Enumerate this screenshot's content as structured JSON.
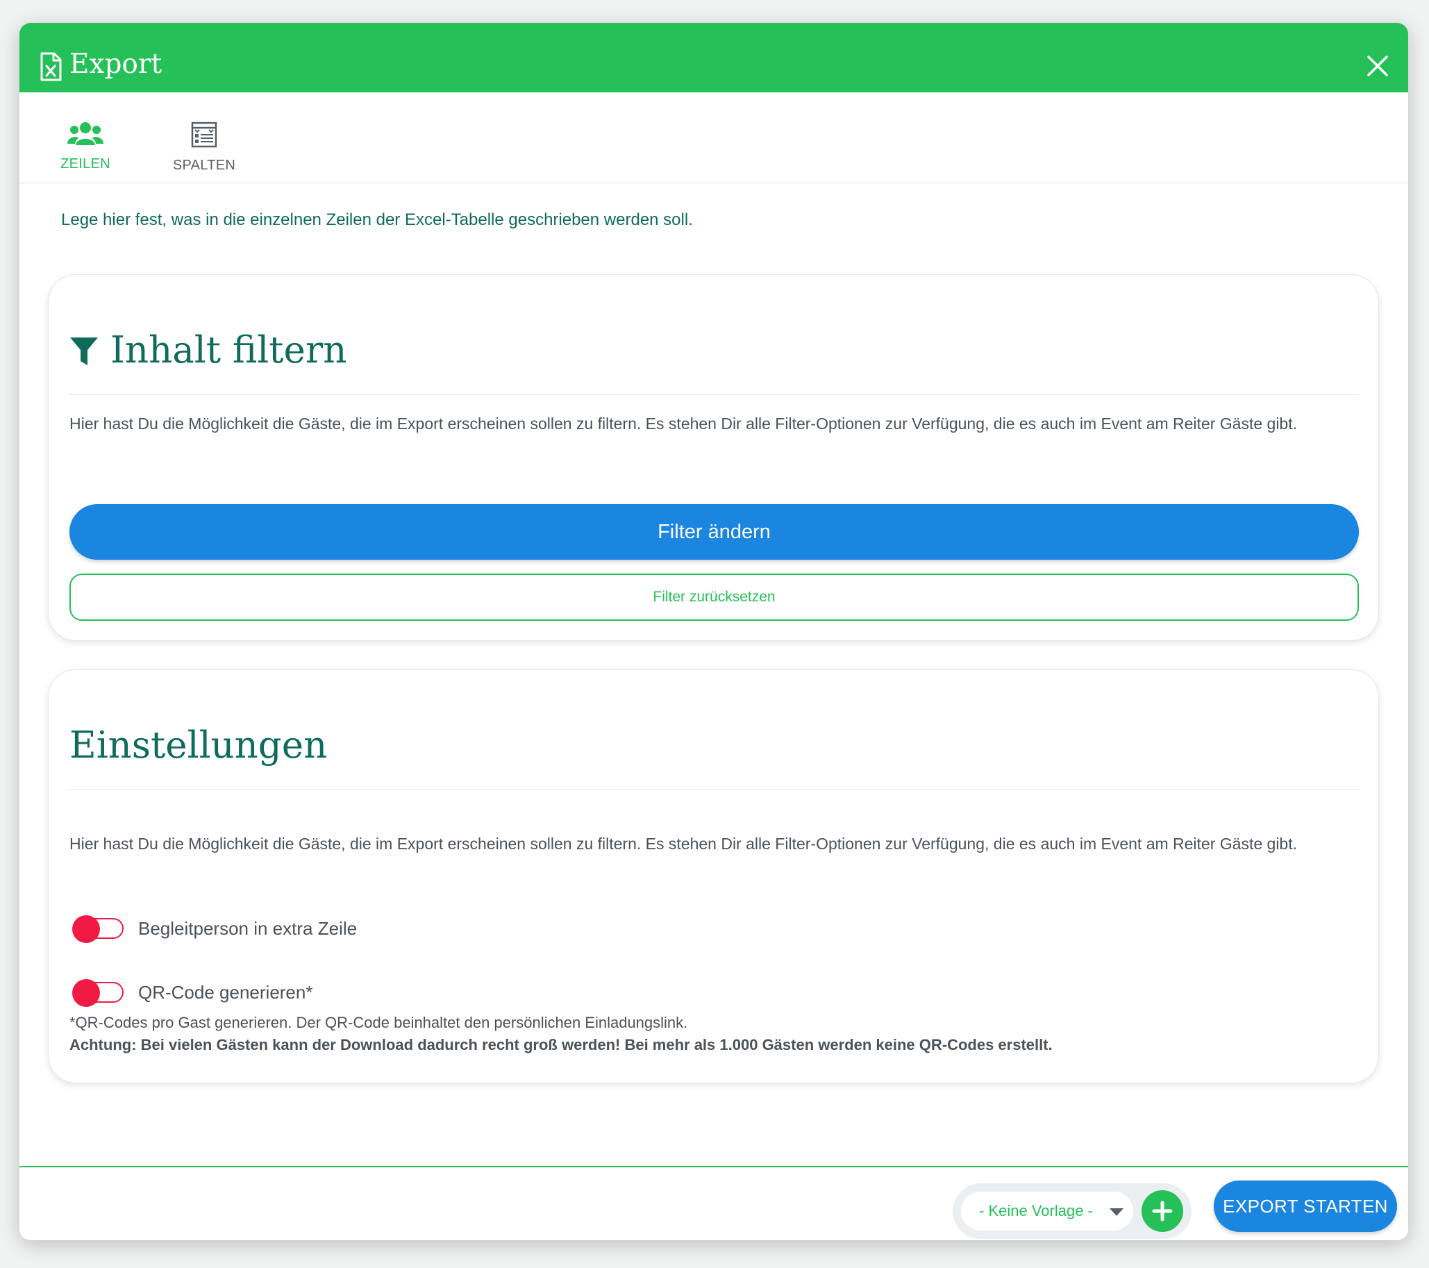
{
  "header": {
    "title": "Export",
    "icon": "excel-file-icon",
    "close_icon": "close-icon"
  },
  "tabs": [
    {
      "label": "ZEILEN",
      "icon": "users-icon",
      "active": true
    },
    {
      "label": "SPALTEN",
      "icon": "columns-table-icon",
      "active": false
    }
  ],
  "intro": "Lege hier fest, was in die einzelnen Zeilen der Excel-Tabelle geschrieben werden soll.",
  "filter_card": {
    "title": "Inhalt filtern",
    "icon": "funnel-icon",
    "description": "Hier hast Du die Möglichkeit die Gäste, die im Export erscheinen sollen zu filtern. Es stehen Dir alle Filter-Optionen zur Verfügung, die es auch im Event am Reiter Gäste gibt.",
    "change_button": "Filter ändern",
    "reset_button": "Filter zurücksetzen"
  },
  "settings_card": {
    "title": "Einstellungen",
    "description": "Hier hast Du die Möglichkeit die Gäste, die im Export erscheinen sollen zu filtern. Es stehen Dir alle Filter-Optionen zur Verfügung, die es auch im Event am Reiter Gäste gibt.",
    "toggles": [
      {
        "label": "Begleitperson in extra Zeile",
        "on": false
      },
      {
        "label": "QR-Code generieren*",
        "on": false
      }
    ],
    "note": "*QR-Codes pro Gast generieren. Der QR-Code beinhaltet den persönlichen Einladungslink.",
    "warning": "Achtung: Bei vielen Gästen kann der Download dadurch recht groß werden! Bei mehr als 1.000 Gästen werden keine QR-Codes erstellt."
  },
  "footer": {
    "template_select": "- Keine Vorlage -",
    "add_icon": "plus-icon",
    "export_button": "EXPORT STARTEN"
  },
  "colors": {
    "brand_green": "#25c057",
    "primary_blue": "#1a86e0",
    "heading_teal": "#0f6b5c",
    "toggle_red": "#f01a45"
  }
}
